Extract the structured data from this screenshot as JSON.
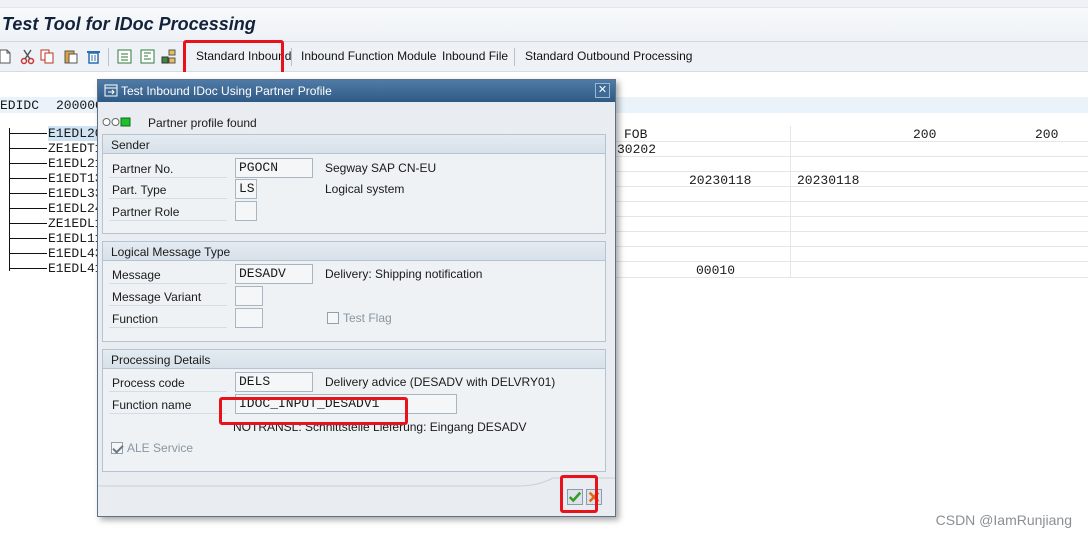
{
  "app": {
    "title": "Test Tool for IDoc Processing"
  },
  "toolbar": {
    "icons": [
      "new-icon",
      "cut-icon",
      "copy-icon",
      "paste-icon",
      "delete-icon",
      "segment-icon",
      "edit-icon",
      "tree-icon"
    ],
    "buttons": [
      "Standard Inbound",
      "Inbound Function Module",
      "Inbound File",
      "Standard Outbound Processing"
    ]
  },
  "background": {
    "control_label": "EDIDC",
    "control_value": "200000",
    "segments": [
      "E1EDL20",
      "ZE1EDT1",
      "E1EDL21",
      "E1EDT13",
      "E1EDL33",
      "E1EDL24",
      "ZE1EDL1",
      "E1EDL11",
      "E1EDL43",
      "E1EDL41"
    ],
    "cells": {
      "r1c1": "FOB",
      "r1c2": "200",
      "r1c3": "200",
      "r2c1": "30202",
      "r4c1": "20230118",
      "r4c2": "20230118",
      "r10c1": "00010"
    }
  },
  "dialog": {
    "title": "Test Inbound IDoc Using Partner Profile",
    "status": "Partner profile found",
    "sender": {
      "header": "Sender",
      "partner_no_label": "Partner No.",
      "partner_no": "PGOCN",
      "partner_no_desc": "Segway SAP CN-EU",
      "part_type_label": "Part. Type",
      "part_type": "LS",
      "part_type_desc": "Logical system",
      "partner_role_label": "Partner Role",
      "partner_role": ""
    },
    "message_type": {
      "header": "Logical Message Type",
      "message_label": "Message",
      "message": "DESADV",
      "message_desc": "Delivery: Shipping notification",
      "variant_label": "Message Variant",
      "variant": "",
      "function_label": "Function",
      "function": "",
      "test_flag_label": "Test Flag"
    },
    "processing": {
      "header": "Processing Details",
      "process_code_label": "Process code",
      "process_code": "DELS",
      "process_code_desc": "Delivery advice (DESADV with DELVRY01)",
      "function_name_label": "Function name",
      "function_name": "IDOC_INPUT_DESADV1",
      "function_name_desc": "NOTRANSL: Schnittstelle Lieferung: Eingang DESADV",
      "ale_label": "ALE Service"
    }
  },
  "watermark": "CSDN @IamRunjiang",
  "colors": {
    "highlight": "#e8121b",
    "title_bar": "#2f5a86",
    "ok_green": "#3a9a2a",
    "cancel_orange": "#e06a10"
  }
}
